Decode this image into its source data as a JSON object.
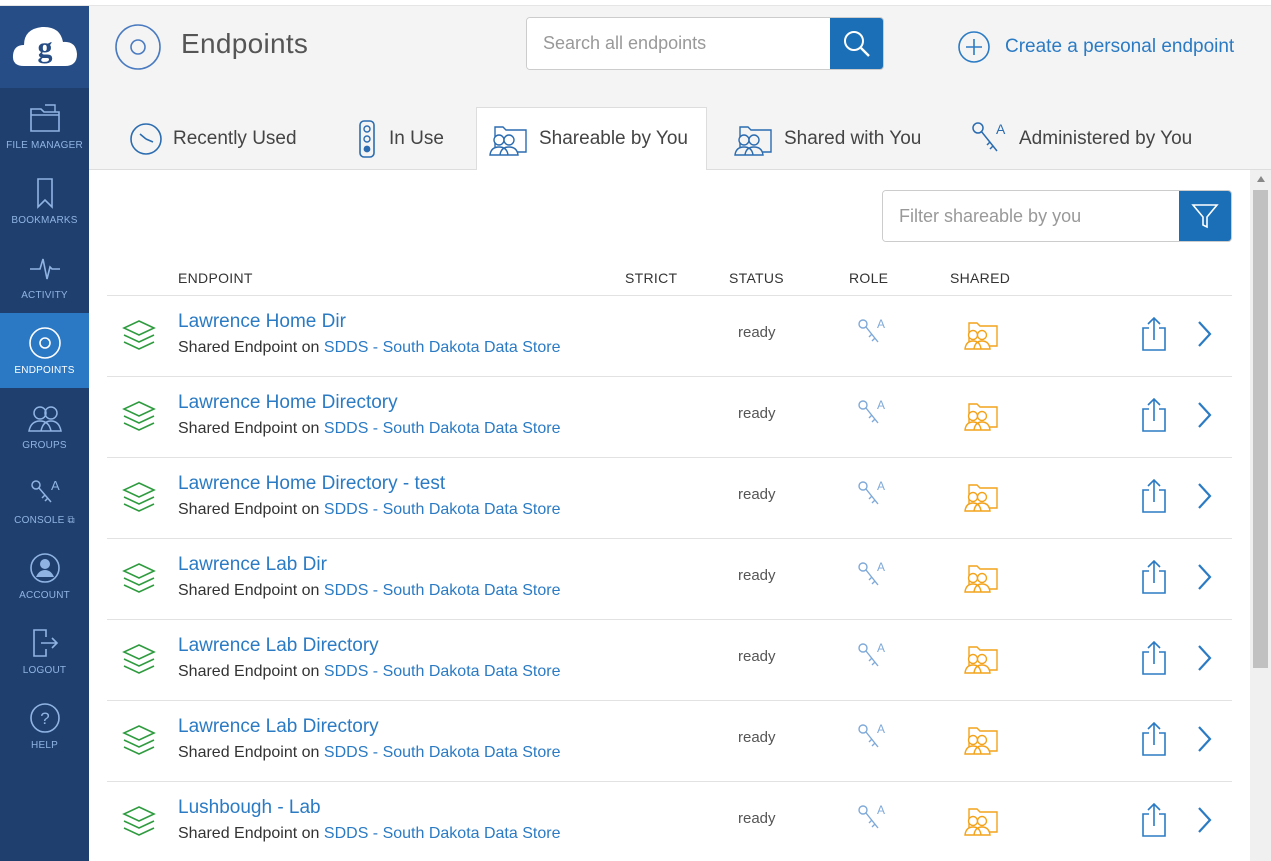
{
  "sidebar": {
    "items": [
      {
        "label": "FILE MANAGER",
        "icon": "file-manager-icon"
      },
      {
        "label": "BOOKMARKS",
        "icon": "bookmark-icon"
      },
      {
        "label": "ACTIVITY",
        "icon": "activity-icon"
      },
      {
        "label": "ENDPOINTS",
        "icon": "endpoint-icon",
        "active": true
      },
      {
        "label": "GROUPS",
        "icon": "groups-icon"
      },
      {
        "label": "CONSOLE",
        "icon": "console-icon"
      },
      {
        "label": "ACCOUNT",
        "icon": "account-icon"
      },
      {
        "label": "LOGOUT",
        "icon": "logout-icon"
      },
      {
        "label": "HELP",
        "icon": "help-icon"
      }
    ]
  },
  "header": {
    "title": "Endpoints",
    "search_placeholder": "Search all endpoints",
    "create_label": "Create a personal endpoint"
  },
  "tabs": [
    {
      "label": "Recently Used"
    },
    {
      "label": "In Use"
    },
    {
      "label": "Shareable by You",
      "active": true
    },
    {
      "label": "Shared with You"
    },
    {
      "label": "Administered by You"
    }
  ],
  "filter": {
    "placeholder": "Filter shareable by you"
  },
  "columns": {
    "endpoint": "ENDPOINT",
    "strict": "STRICT",
    "status": "STATUS",
    "role": "ROLE",
    "shared": "SHARED"
  },
  "rows": [
    {
      "name": "Lawrence Home Dir",
      "sub_prefix": "Shared Endpoint on",
      "host": "SDDS - South Dakota Data Store",
      "status": "ready"
    },
    {
      "name": "Lawrence Home Directory",
      "sub_prefix": "Shared Endpoint on",
      "host": "SDDS - South Dakota Data Store",
      "status": "ready"
    },
    {
      "name": "Lawrence Home Directory - test",
      "sub_prefix": "Shared Endpoint on",
      "host": "SDDS - South Dakota Data Store",
      "status": "ready"
    },
    {
      "name": "Lawrence Lab Dir",
      "sub_prefix": "Shared Endpoint on",
      "host": "SDDS - South Dakota Data Store",
      "status": "ready"
    },
    {
      "name": "Lawrence Lab Directory",
      "sub_prefix": "Shared Endpoint on",
      "host": "SDDS - South Dakota Data Store",
      "status": "ready"
    },
    {
      "name": "Lawrence Lab Directory",
      "sub_prefix": "Shared Endpoint on",
      "host": "SDDS - South Dakota Data Store",
      "status": "ready"
    },
    {
      "name": "Lushbough - Lab",
      "sub_prefix": "Shared Endpoint on",
      "host": "SDDS - South Dakota Data Store",
      "status": "ready"
    }
  ],
  "colors": {
    "sidebar_bg": "#1f3f6e",
    "sidebar_active": "#2b78c5",
    "accent_blue": "#1a6fb7",
    "link_blue": "#2b7bc4",
    "endpoint_green": "#2e9b3f",
    "shared_orange": "#f3a31b"
  }
}
